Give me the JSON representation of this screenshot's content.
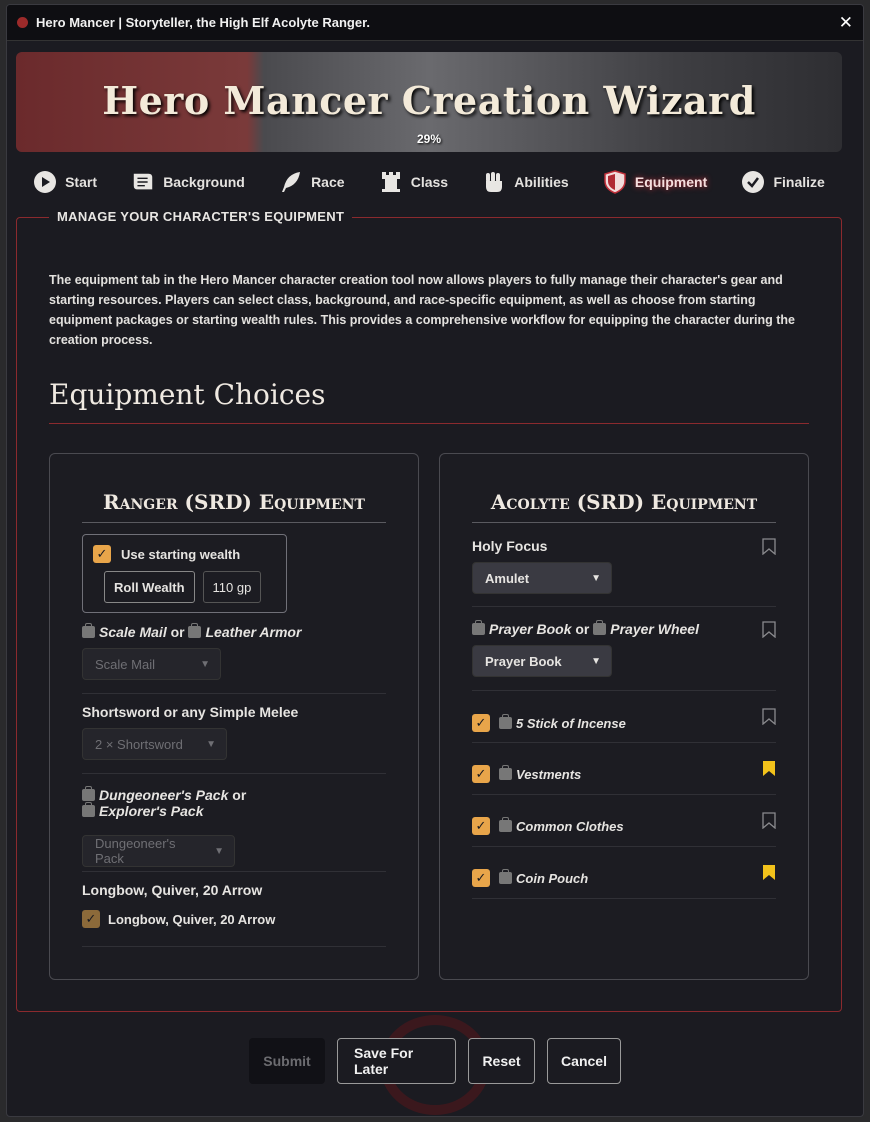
{
  "window": {
    "title": "Hero Mancer | Storyteller, the High Elf Acolyte Ranger."
  },
  "banner": {
    "title": "Hero Mancer Creation Wizard",
    "progress": "29%"
  },
  "nav": [
    {
      "label": "Start"
    },
    {
      "label": "Background"
    },
    {
      "label": "Race"
    },
    {
      "label": "Class"
    },
    {
      "label": "Abilities"
    },
    {
      "label": "Equipment"
    },
    {
      "label": "Finalize"
    }
  ],
  "panel": {
    "legend": "MANAGE YOUR CHARACTER'S EQUIPMENT",
    "intro": "The equipment tab in the Hero Mancer character creation tool now allows players to fully manage their character's gear and starting resources. Players can select class, background, and race-specific equipment, as well as choose from starting equipment packages or starting wealth rules. This provides a comprehensive workflow for equipping the character during the creation process.",
    "section_title": "Equipment Choices"
  },
  "left": {
    "title": "Ranger (SRD) Equipment",
    "wealth": {
      "label": "Use starting wealth",
      "roll_label": "Roll Wealth",
      "value": "110 gp"
    },
    "armor": {
      "opt1": "Scale Mail",
      "or": "or",
      "opt2": "Leather Armor",
      "select": "Scale Mail"
    },
    "weapon": {
      "label": "Shortsword or any Simple Melee",
      "select": "2 × Shortsword"
    },
    "pack": {
      "opt1": "Dungeoneer's Pack",
      "or": "or",
      "opt2": "Explorer's Pack",
      "select": "Dungeoneer's Pack"
    },
    "bow": {
      "label": "Longbow, Quiver, 20 Arrow",
      "check_label": "Longbow, Quiver, 20 Arrow"
    }
  },
  "right": {
    "title": "Acolyte (SRD) Equipment",
    "focus": {
      "label": "Holy Focus",
      "select": "Amulet"
    },
    "book": {
      "opt1": "Prayer Book",
      "or": "or",
      "opt2": "Prayer Wheel",
      "select": "Prayer Book"
    },
    "items": [
      {
        "label": "5 Stick of Incense",
        "favorited": false
      },
      {
        "label": "Vestments",
        "favorited": true
      },
      {
        "label": "Common Clothes",
        "favorited": false
      },
      {
        "label": "Coin Pouch",
        "favorited": true
      }
    ]
  },
  "footer": {
    "submit": "Submit",
    "save": "Save For Later",
    "reset": "Reset",
    "cancel": "Cancel"
  },
  "colors": {
    "accent": "#8b2a2e",
    "checkbox": "#e8a54a",
    "bookmark_active": "#f2c21b"
  }
}
